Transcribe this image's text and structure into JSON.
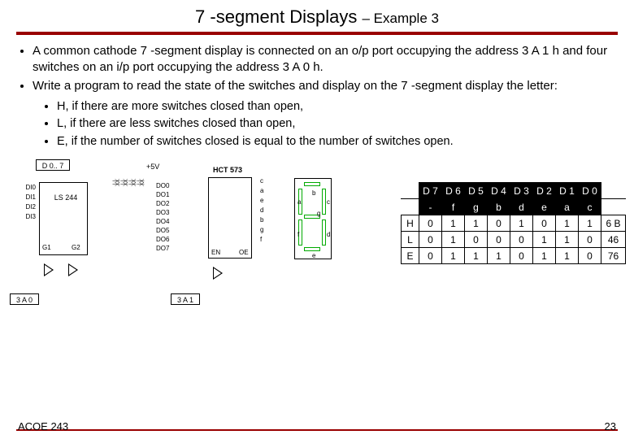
{
  "title": {
    "main": "7 -segment Displays",
    "sub": "– Example 3"
  },
  "bullets": {
    "b1": "A common cathode 7 -segment display is connected on an o/p port occupying the address 3 A 1 h and four switches on an i/p port occupying the address 3 A 0 h.",
    "b2": "Write a program to read the state of the switches and display on the 7 -segment display the letter:",
    "s1": "H, if there are more switches closed than open,",
    "s2": "L, if there are less switches closed  than open,",
    "s3": "E, if the number of switches closed is equal to the number of switches open."
  },
  "circuit": {
    "d07": "D 0.. 7",
    "ls244": "LS 244",
    "plus5v": "+5V",
    "hct573": "HCT 573",
    "addr3a0": "3 A 0",
    "addr3a1": "3 A 1",
    "di": [
      "DI0",
      "DI1",
      "DI2",
      "DI3"
    ],
    "do": [
      "DO0",
      "DO1",
      "DO2",
      "DO3",
      "DO4",
      "DO5",
      "DO6",
      "DO7"
    ],
    "g1": "G1",
    "g2": "G2",
    "en": "EN",
    "oe": "OE",
    "seglabels": {
      "a": "a",
      "b": "b",
      "c": "c",
      "d": "d",
      "e": "e",
      "f": "f",
      "g": "g"
    }
  },
  "table": {
    "head1": [
      "D 7",
      "D 6",
      "D 5",
      "D 4",
      "D 3",
      "D 2",
      "D 1",
      "D 0"
    ],
    "head2": [
      "-",
      "f",
      "g",
      "b",
      "d",
      "e",
      "a",
      "c"
    ],
    "rows": [
      {
        "label": "H",
        "bits": [
          "0",
          "1",
          "1",
          "0",
          "1",
          "0",
          "1",
          "1"
        ],
        "hex": "6 B"
      },
      {
        "label": "L",
        "bits": [
          "0",
          "1",
          "0",
          "0",
          "0",
          "1",
          "1",
          "0"
        ],
        "hex": "46"
      },
      {
        "label": "E",
        "bits": [
          "0",
          "1",
          "1",
          "1",
          "0",
          "1",
          "1",
          "0"
        ],
        "hex": "76"
      }
    ]
  },
  "footer": {
    "left": "ACOE 243",
    "right": "23"
  }
}
